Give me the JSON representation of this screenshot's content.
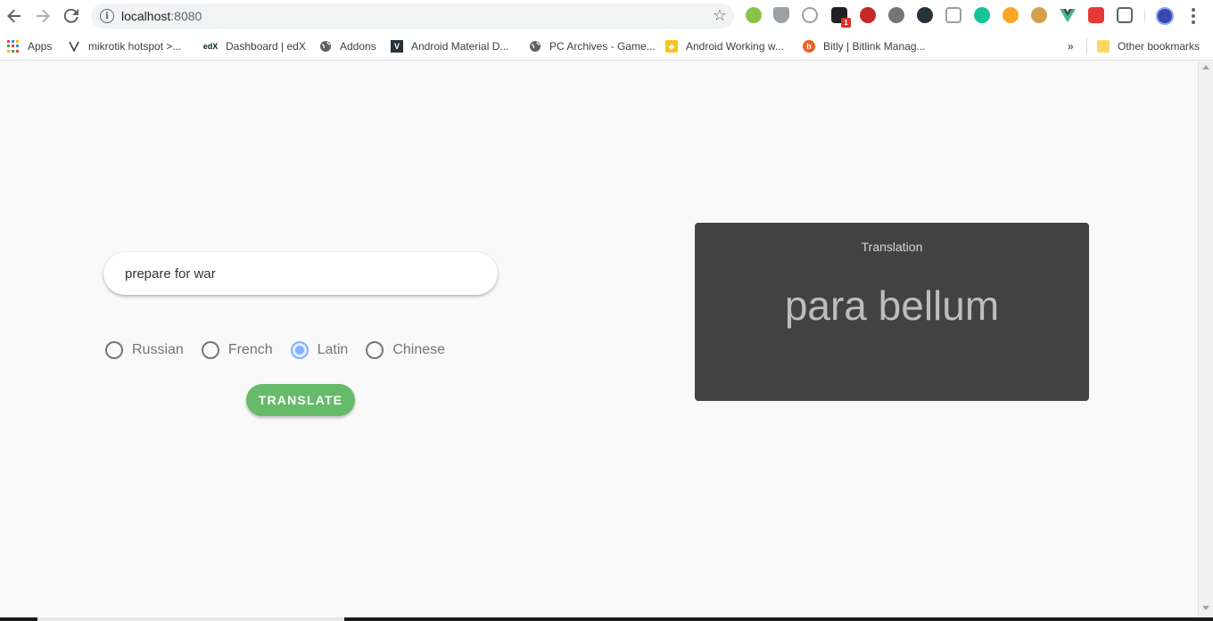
{
  "browser": {
    "url_host": "localhost",
    "url_port": ":8080",
    "icons": {
      "back": "arrow-left",
      "forward": "arrow-right",
      "reload": "reload",
      "info": "info",
      "bookmark_star": "star",
      "menu": "kebab"
    },
    "bookmarks": [
      {
        "label": "Apps",
        "icon": "apps-grid"
      },
      {
        "label": "mikrotik hotspot >...",
        "icon": "mikrotik"
      },
      {
        "label": "Dashboard | edX",
        "icon": "edx"
      },
      {
        "label": "Addons",
        "icon": "globe"
      },
      {
        "label": "Android Material D...",
        "icon": "v-logo"
      },
      {
        "label": "PC Archives - Game...",
        "icon": "globe"
      },
      {
        "label": "Android Working w...",
        "icon": "yellow-square"
      },
      {
        "label": "Bitly | Bitlink Manag...",
        "icon": "bitly"
      }
    ],
    "overflow": "»",
    "other_bookmarks": "Other bookmarks",
    "extension_badge": "1"
  },
  "app": {
    "input_value": "prepare for war",
    "languages": [
      {
        "label": "Russian",
        "checked": false
      },
      {
        "label": "French",
        "checked": false
      },
      {
        "label": "Latin",
        "checked": true
      },
      {
        "label": "Chinese",
        "checked": false
      }
    ],
    "translate_label": "Translate",
    "card_title": "Translation",
    "translation": "para bellum"
  },
  "colors": {
    "button_green": "#66bb6a",
    "radio_selected": "#82b1ff",
    "card_bg": "#424242"
  }
}
